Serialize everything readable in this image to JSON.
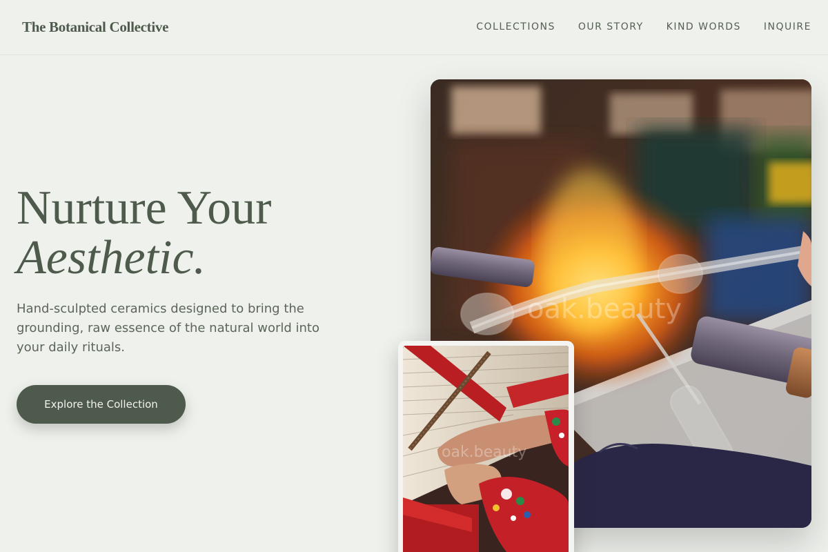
{
  "brand": {
    "name": "The Botanical Collective"
  },
  "nav": {
    "items": [
      {
        "label": "COLLECTIONS"
      },
      {
        "label": "OUR STORY"
      },
      {
        "label": "KIND WORDS"
      },
      {
        "label": "INQUIRE"
      }
    ]
  },
  "hero": {
    "headline_line1": "Nurture Your",
    "headline_line2": "Aesthetic.",
    "lead": "Hand-sculpted ceramics designed to bring the grounding, raw essence of the natural world into your daily rituals.",
    "cta_label": "Explore the Collection"
  },
  "images": {
    "main_watermark": "oak.beauty",
    "inset_watermark": "oak.beauty"
  },
  "colors": {
    "background": "#eff1ed",
    "accent": "#4e5a4b",
    "text": "#5b6658"
  }
}
